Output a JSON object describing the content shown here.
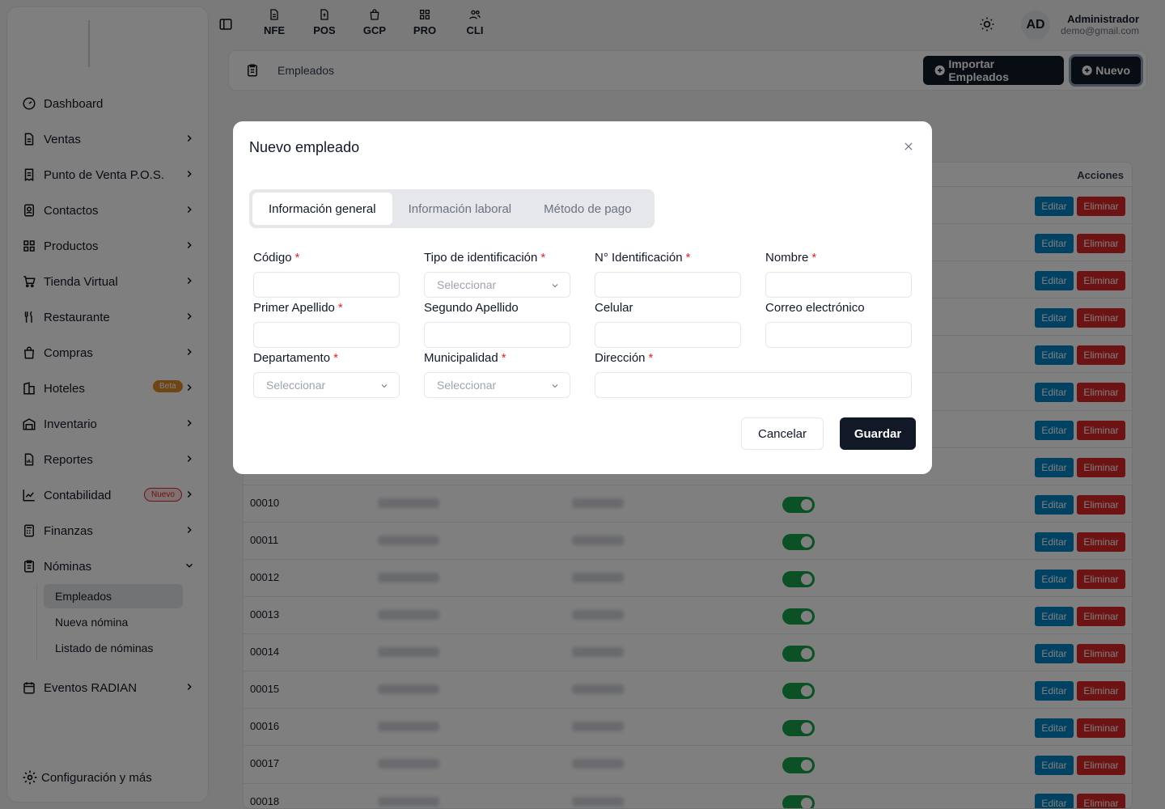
{
  "sidebar": {
    "items": [
      {
        "label": "Dashboard",
        "icon": "gauge-icon"
      },
      {
        "label": "Ventas",
        "icon": "document-icon"
      },
      {
        "label": "Punto de Venta P.O.S.",
        "icon": "receipt-icon"
      },
      {
        "label": "Contactos",
        "icon": "contact-book-icon"
      },
      {
        "label": "Productos",
        "icon": "grid-icon"
      },
      {
        "label": "Tienda Virtual",
        "icon": "cart-icon"
      },
      {
        "label": "Restaurante",
        "icon": "utensils-icon"
      },
      {
        "label": "Compras",
        "icon": "shopping-bag-icon"
      },
      {
        "label": "Hoteles",
        "icon": "hotel-icon",
        "badge": "Beta"
      },
      {
        "label": "Inventario",
        "icon": "warehouse-icon"
      },
      {
        "label": "Reportes",
        "icon": "report-icon"
      },
      {
        "label": "Contabilidad",
        "icon": "chart-icon",
        "badge": "Nuevo"
      },
      {
        "label": "Finanzas",
        "icon": "calculator-icon"
      },
      {
        "label": "Nóminas",
        "icon": "clipboard-icon"
      }
    ],
    "nominas_sub": [
      "Empleados",
      "Nueva nómina",
      "Listado de nóminas"
    ],
    "eventos": "Eventos RADIAN",
    "config": "Configuración y más"
  },
  "topbar": {
    "modules": [
      "NFE",
      "POS",
      "GCP",
      "PRO",
      "CLI"
    ],
    "avatar": "AD",
    "user_name": "Administrador",
    "user_email": "demo@gmail.com"
  },
  "page": {
    "title": "Empleados",
    "import_label": "Importar Empleados",
    "new_label": "Nuevo"
  },
  "table": {
    "actions_header": "Acciones",
    "edit_label": "Editar",
    "delete_label": "Eliminar",
    "visible_codes": [
      "00010",
      "00011",
      "00012",
      "00013",
      "00014",
      "00015",
      "00016",
      "00017",
      "00018"
    ]
  },
  "modal": {
    "title": "Nuevo empleado",
    "tabs": [
      "Información general",
      "Información laboral",
      "Método de pago"
    ],
    "active_tab": "Información general",
    "fields": {
      "codigo": "Código",
      "tipo_id": "Tipo de identificación",
      "num_id": "N° Identificación",
      "nombre": "Nombre",
      "primer_apellido": "Primer Apellido",
      "segundo_apellido": "Segundo Apellido",
      "celular": "Celular",
      "correo": "Correo electrónico",
      "departamento": "Departamento",
      "municipalidad": "Municipalidad",
      "direccion": "Dirección"
    },
    "select_placeholder": "Seleccionar",
    "required_mark": "*",
    "cancel_label": "Cancelar",
    "save_label": "Guardar"
  },
  "colors": {
    "primary_dark": "#111827",
    "edit_blue": "#0284c7",
    "delete_red": "#dc2626",
    "toggle_green": "#16a34a",
    "required_red": "#dc2626"
  }
}
